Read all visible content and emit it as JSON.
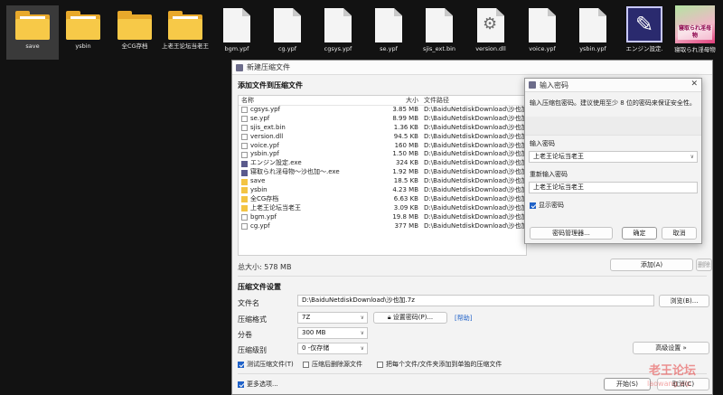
{
  "desktop": {
    "icons": [
      {
        "label": "save",
        "kind": "folder",
        "selected": true
      },
      {
        "label": "ysbin",
        "kind": "folder"
      },
      {
        "label": "全CG存档",
        "kind": "folder"
      },
      {
        "label": "上老王论坛当老王",
        "kind": "folder"
      },
      {
        "label": "bgm.ypf",
        "kind": "file"
      },
      {
        "label": "cg.ypf",
        "kind": "file"
      },
      {
        "label": "cgsys.ypf",
        "kind": "file"
      },
      {
        "label": "se.ypf",
        "kind": "file"
      },
      {
        "label": "sjis_ext.bin",
        "kind": "file"
      },
      {
        "label": "version.dll",
        "kind": "dll"
      },
      {
        "label": "voice.ypf",
        "kind": "file"
      },
      {
        "label": "ysbin.ypf",
        "kind": "file"
      },
      {
        "label": "エンジン設定.",
        "kind": "app"
      },
      {
        "label": "寝取られ淫母物",
        "kind": "image",
        "image_text": "寝取られ淫母物"
      }
    ]
  },
  "main_window": {
    "title": "新建压缩文件",
    "add_section_title": "添加文件到压缩文件",
    "columns": {
      "name": "名称",
      "size": "大小",
      "path": "文件路径"
    },
    "files": [
      {
        "name": "cgsys.ypf",
        "size": "3.85 MB",
        "path": "D:\\BaiduNetdiskDownload\\沙也加\\",
        "type": "doc"
      },
      {
        "name": "se.ypf",
        "size": "8.99 MB",
        "path": "D:\\BaiduNetdiskDownload\\沙也加\\",
        "type": "doc"
      },
      {
        "name": "sjis_ext.bin",
        "size": "1.36 KB",
        "path": "D:\\BaiduNetdiskDownload\\沙也加\\",
        "type": "doc"
      },
      {
        "name": "version.dll",
        "size": "94.5 KB",
        "path": "D:\\BaiduNetdiskDownload\\沙也加\\",
        "type": "doc"
      },
      {
        "name": "voice.ypf",
        "size": "160 MB",
        "path": "D:\\BaiduNetdiskDownload\\沙也加\\",
        "type": "doc"
      },
      {
        "name": "ysbin.ypf",
        "size": "1.50 MB",
        "path": "D:\\BaiduNetdiskDownload\\沙也加\\",
        "type": "doc"
      },
      {
        "name": "エンジン設定.exe",
        "size": "324 KB",
        "path": "D:\\BaiduNetdiskDownload\\沙也加\\",
        "type": "exe"
      },
      {
        "name": "寝取られ淫母物～沙也加～.exe",
        "size": "1.92 MB",
        "path": "D:\\BaiduNetdiskDownload\\沙也加\\",
        "type": "exe"
      },
      {
        "name": "save",
        "size": "18.5 KB",
        "path": "D:\\BaiduNetdiskDownload\\沙也加\\",
        "type": "folder"
      },
      {
        "name": "ysbin",
        "size": "4.23 MB",
        "path": "D:\\BaiduNetdiskDownload\\沙也加\\",
        "type": "folder"
      },
      {
        "name": "全CG存档",
        "size": "6.63 KB",
        "path": "D:\\BaiduNetdiskDownload\\沙也加\\",
        "type": "folder"
      },
      {
        "name": "上老王论坛当老王",
        "size": "3.09 KB",
        "path": "D:\\BaiduNetdiskDownload\\沙也加\\",
        "type": "folder"
      },
      {
        "name": "bgm.ypf",
        "size": "19.8 MB",
        "path": "D:\\BaiduNetdiskDownload\\沙也加\\",
        "type": "doc"
      },
      {
        "name": "cg.ypf",
        "size": "377 MB",
        "path": "D:\\BaiduNetdiskDownload\\沙也加\\",
        "type": "doc"
      }
    ],
    "total_size": "总大小: 578 MB",
    "add_button": "添加(A)",
    "delete_button": "删除(D)",
    "settings_title": "压缩文件设置",
    "filename_label": "文件名",
    "filename_value": "D:\\BaiduNetdiskDownload\\沙也加.7z",
    "browse_button": "浏览(B)...",
    "format_label": "压缩格式",
    "format_value": "7Z",
    "set_password_button": "设置密码(P)...",
    "help_link": "[帮助]",
    "volume_label": "分卷",
    "volume_value": "300 MB",
    "level_label": "压缩级别",
    "level_value": "0 -仅存储",
    "advanced_button": "高级设置 »",
    "test_checkbox": "测试压缩文件(T)",
    "test_checked": true,
    "delete_after_checkbox": "压缩后删除源文件",
    "delete_after_checked": false,
    "separate_checkbox": "把每个文件/文件夹添加到单独的压缩文件",
    "separate_checked": false,
    "more_options_checkbox": "更多选项...",
    "more_options_checked": true,
    "start_button": "开始(S)",
    "cancel_button": "取消(C)"
  },
  "password_dialog": {
    "title": "输入密码",
    "hint": "输入压缩包密码。建议使用至少 8 位的密码来保证安全性。",
    "password_label": "输入密码",
    "password_value": "上老王论坛当老王",
    "confirm_label": "重新输入密码",
    "confirm_value": "上老王论坛当老王",
    "show_password": "显示密码",
    "show_password_checked": true,
    "manager_button": "密码管理器...",
    "ok_button": "确定",
    "cancel_button": "取消"
  },
  "watermark": {
    "line1": "老王论坛",
    "line2": "laowang.vip"
  },
  "colors": {
    "accent": "#2062c8",
    "folder": "#f7c948",
    "desktop_bg": "#121212"
  }
}
